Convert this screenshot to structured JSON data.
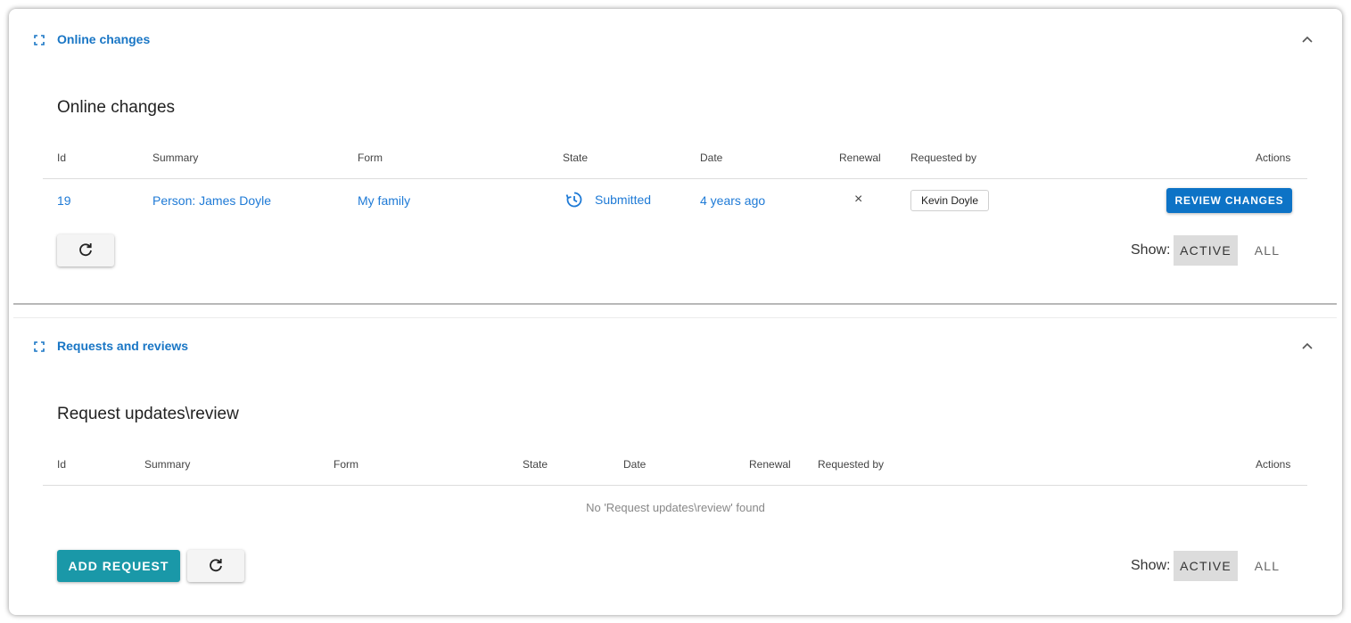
{
  "online_changes": {
    "section_title": "Online changes",
    "table_title": "Online changes",
    "columns": [
      "Id",
      "Summary",
      "Form",
      "State",
      "Date",
      "Renewal",
      "Requested by",
      "Actions"
    ],
    "rows": [
      {
        "id": "19",
        "summary": "Person: James Doyle",
        "form": "My family",
        "state": "Submitted",
        "date": "4 years ago",
        "renewal": "×",
        "requested_by": "Kevin Doyle",
        "action": "REVIEW CHANGES"
      }
    ],
    "show_label": "Show:",
    "filter_active": "ACTIVE",
    "filter_all": "ALL"
  },
  "requests_reviews": {
    "section_title": "Requests and reviews",
    "table_title": "Request updates\\review",
    "columns": [
      "Id",
      "Summary",
      "Form",
      "State",
      "Date",
      "Renewal",
      "Requested by",
      "Actions"
    ],
    "empty_message": "No 'Request updates\\review' found",
    "add_button": "ADD REQUEST",
    "show_label": "Show:",
    "filter_active": "ACTIVE",
    "filter_all": "ALL"
  },
  "colors": {
    "link": "#1e7ad6",
    "section_title": "#1976c5",
    "primary_button": "#0d73c6",
    "teal_button": "#1a98a8",
    "toggle_active_bg": "#dcdcdc"
  },
  "icons": [
    "expand-icon",
    "chevron-up-icon",
    "refresh-icon",
    "clock-history-icon",
    "close-icon"
  ]
}
